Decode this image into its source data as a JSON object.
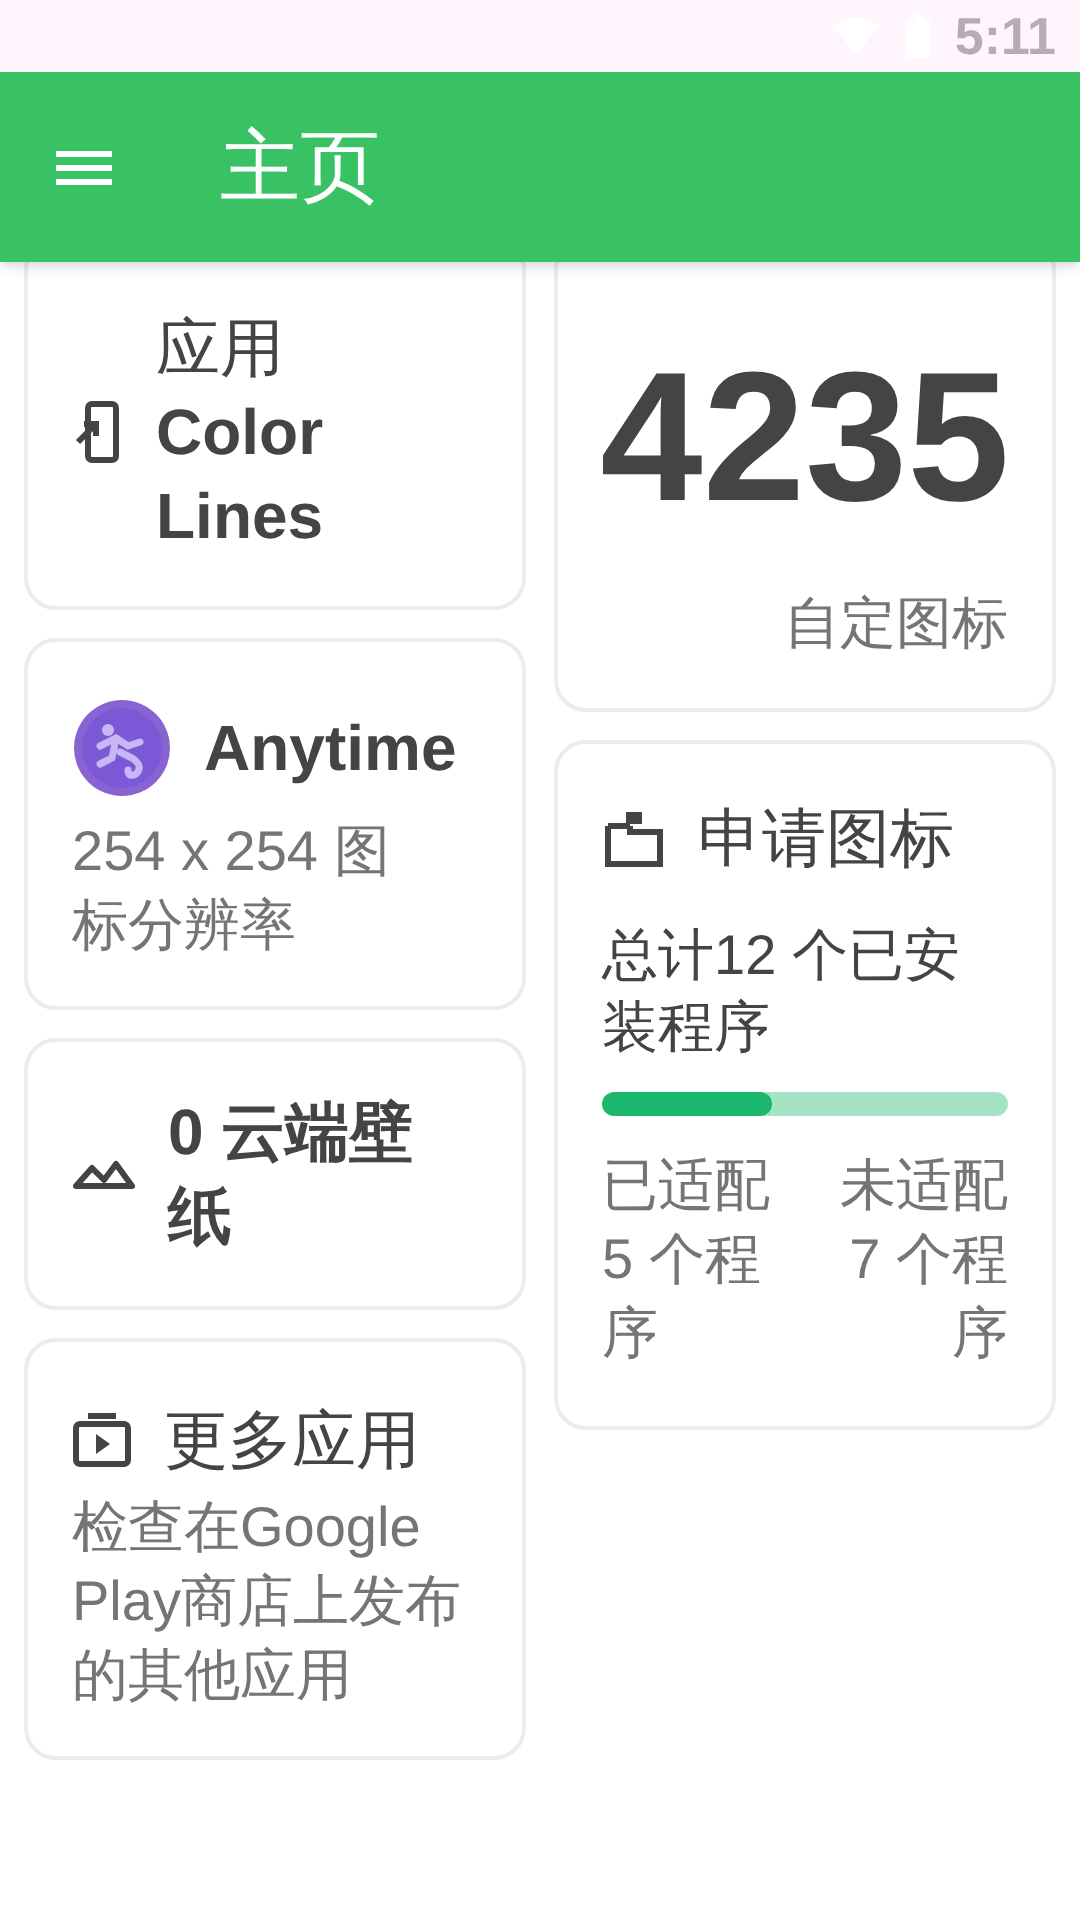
{
  "status_bar": {
    "time": "5:11"
  },
  "app_bar": {
    "title": "主页"
  },
  "left_cards": [
    {
      "kind": "app",
      "title_top": "应用",
      "title": "Color Lines"
    },
    {
      "kind": "icon_pack",
      "title": "Anytime",
      "description": "254 x 254 图标分辨率"
    },
    {
      "kind": "wallpapers",
      "title": "0 云端壁纸"
    },
    {
      "kind": "more_apps",
      "title": "更多应用",
      "description": "检查在Google Play商店上发布的其他应用"
    }
  ],
  "icons_card": {
    "count": "4235",
    "label": "自定图标"
  },
  "request_card": {
    "title": "申请图标",
    "summary": "总计12 个已安装程序",
    "progress": {
      "level": 0.42
    },
    "themed": "已适配 5 个程序",
    "unthemed": "未适配 7 个程序"
  }
}
